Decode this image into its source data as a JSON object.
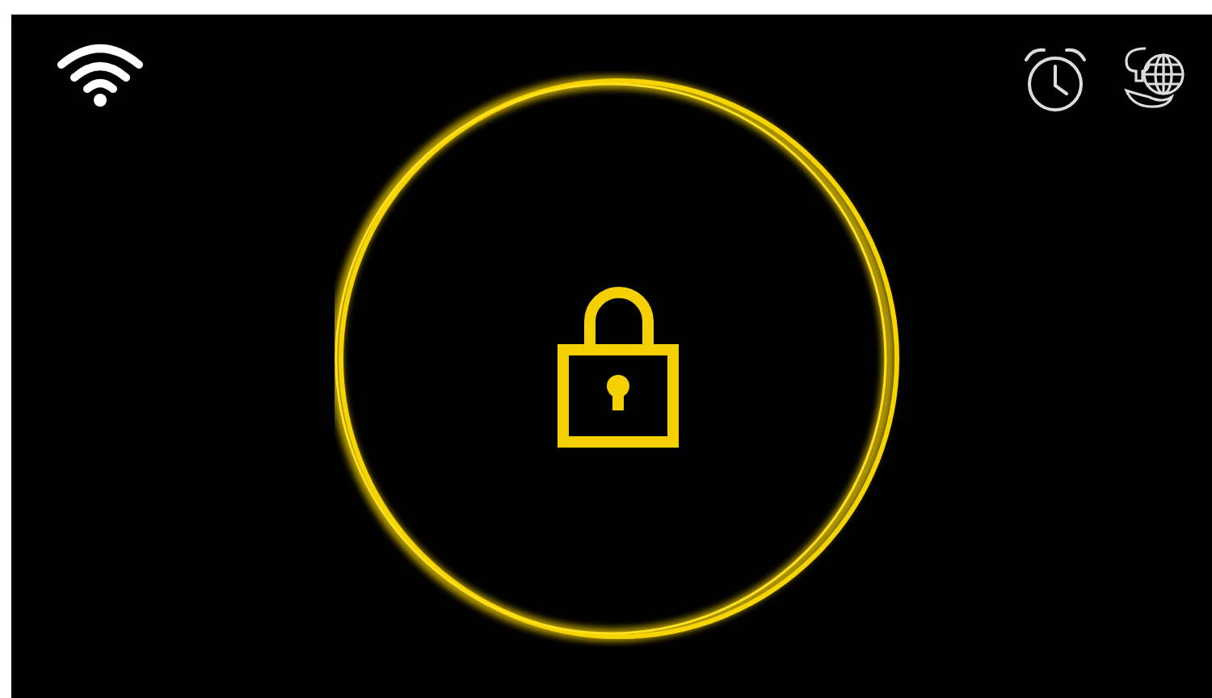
{
  "lock_button": {
    "locked": true
  }
}
